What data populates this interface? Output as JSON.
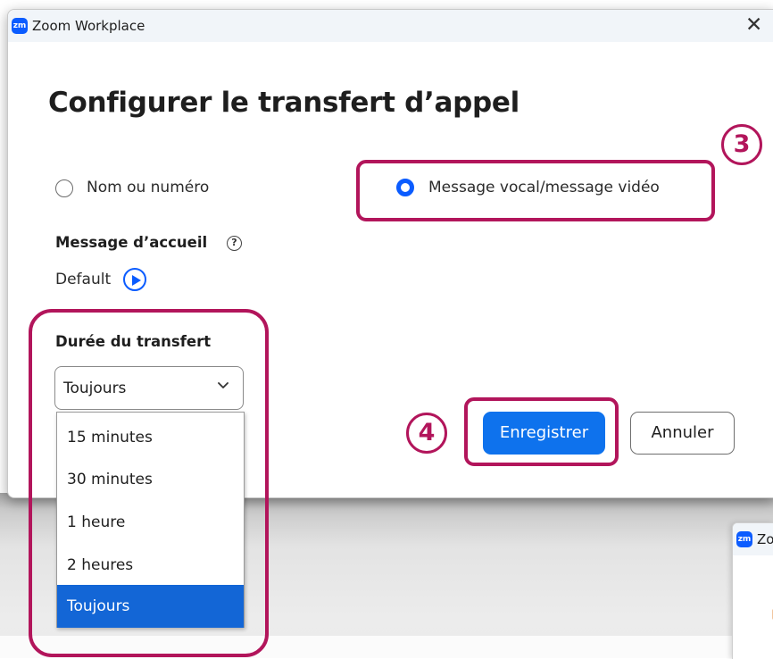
{
  "window": {
    "logo_text": "zm",
    "title": "Zoom Workplace",
    "close_glyph": "✕"
  },
  "dialog": {
    "heading": "Configurer le transfert d’appel",
    "options": {
      "name_or_number": "Nom ou numéro",
      "voicemail": "Message vocal/message vidéo",
      "selected": "voicemail"
    },
    "greeting": {
      "label": "Message d’accueil",
      "help_glyph": "?",
      "value": "Default"
    },
    "duration": {
      "label": "Durée du transfert",
      "selected_value": "Toujours",
      "dropdown_options": [
        "15 minutes",
        "30 minutes",
        "1 heure",
        "2 heures",
        "Toujours"
      ]
    },
    "buttons": {
      "save": "Enregistrer",
      "cancel": "Annuler"
    }
  },
  "annotations": {
    "step3": "3",
    "step4": "4",
    "highlight_color": "#b2155b"
  },
  "second_window": {
    "logo_text": "zm",
    "title_partial": "Zo"
  },
  "colors": {
    "accent": "#0b5cff",
    "button_primary": "#0e72ed",
    "dropdown_selected": "#1366d6"
  }
}
